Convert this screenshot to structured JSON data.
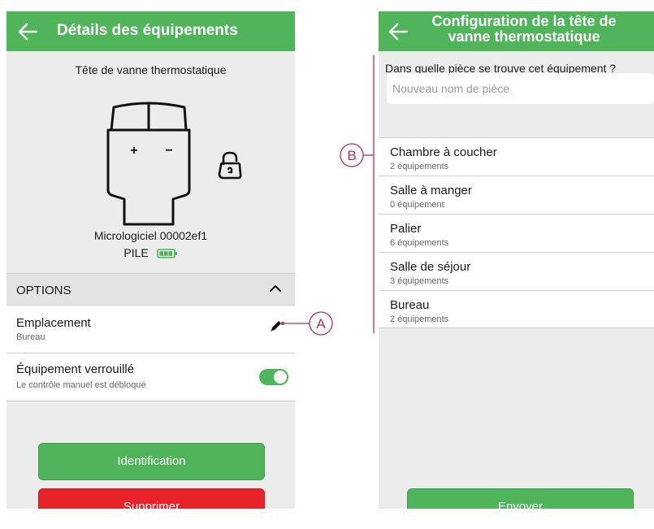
{
  "left_screen": {
    "title": "Détails des équipements",
    "device_name": "Tête de vanne thermostatique",
    "firmware": "Micrologiciel 00002ef1",
    "battery_label": "PILE",
    "options_label": "OPTIONS",
    "location": {
      "title": "Emplacement",
      "value": "Bureau"
    },
    "lock": {
      "title": "Équipement verrouillé",
      "subtitle": "Le contrôle manuel est débloqué",
      "enabled": true
    },
    "buttons": {
      "identification": "Identification",
      "delete": "Supprimer"
    }
  },
  "right_screen": {
    "title_line1": "Configuration de la tête de",
    "title_line2": "vanne thermostatique",
    "question": "Dans quelle pièce se trouve cet équipement ?",
    "new_room_placeholder": "Nouveau nom de pièce",
    "rooms": [
      {
        "name": "Chambre à coucher",
        "count": "2 équipements"
      },
      {
        "name": "Salle à manger",
        "count": "0 équipement"
      },
      {
        "name": "Palier",
        "count": "6 équipements"
      },
      {
        "name": "Salle de séjour",
        "count": "3 équipements"
      },
      {
        "name": "Bureau",
        "count": "2 équipements"
      }
    ],
    "send_button": "Envoyer"
  },
  "annotations": {
    "a": "A",
    "b": "B"
  },
  "colors": {
    "accent_green": "#4fb45a",
    "danger_red": "#e8222b",
    "annotation": "#b22f5b",
    "background": "#ececec"
  }
}
